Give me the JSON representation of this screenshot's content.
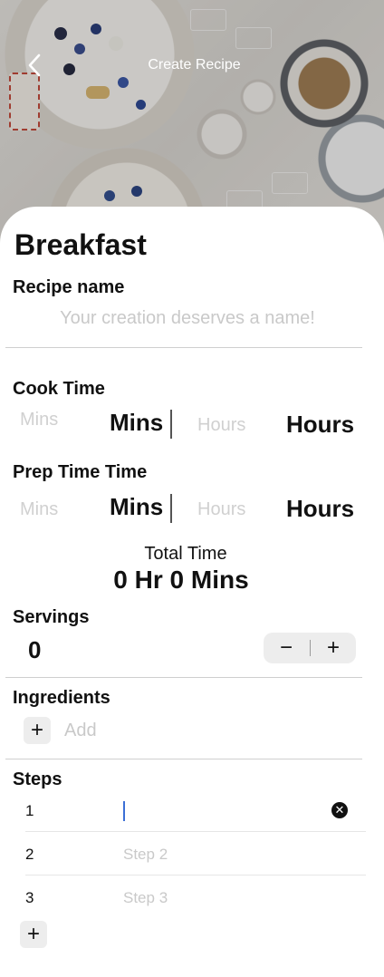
{
  "header": {
    "title": "Create Recipe",
    "back_icon": "chevron-left-icon"
  },
  "category": "Breakfast",
  "recipe_name": {
    "label": "Recipe name",
    "placeholder": "Your creation deserves a name!",
    "value": ""
  },
  "cook_time": {
    "label": "Cook Time",
    "mins_placeholder": "Mins",
    "mins_label": "Mins",
    "hours_placeholder": "Hours",
    "hours_label": "Hours"
  },
  "prep_time": {
    "label": "Prep Time Time",
    "mins_placeholder": "Mins",
    "mins_label": "Mins",
    "hours_placeholder": "Hours",
    "hours_label": "Hours"
  },
  "total_time": {
    "label": "Total Time",
    "value": "0 Hr 0 Mins"
  },
  "servings": {
    "label": "Servings",
    "value": "0",
    "minus": "−",
    "plus": "+"
  },
  "ingredients": {
    "label": "Ingredients",
    "add_button": "+",
    "add_placeholder": "Add"
  },
  "steps": {
    "label": "Steps",
    "items": [
      {
        "number": "1",
        "placeholder": "",
        "value": ""
      },
      {
        "number": "2",
        "placeholder": "Step 2",
        "value": ""
      },
      {
        "number": "3",
        "placeholder": "Step 3",
        "value": ""
      }
    ],
    "add_button": "+",
    "clear_icon": "close-circle-icon"
  },
  "colors": {
    "caret": "#3c6fd6",
    "divider": "#cfcfcf",
    "placeholder": "#c9c9c9",
    "stepper_bg": "#ededed"
  }
}
